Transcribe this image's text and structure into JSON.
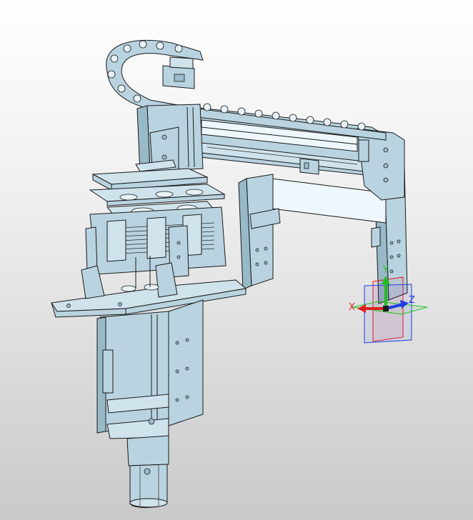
{
  "viewport": {
    "background_top": "#ffffff",
    "background_bottom": "#c9c9c9"
  },
  "model": {
    "part_color": "#b9d4e0",
    "edge_color": "#1a1a1a"
  },
  "triad": {
    "x_label": "X",
    "y_label": "Y",
    "z_label": "Z",
    "x_color": "#e02020",
    "y_color": "#20c020",
    "z_color": "#2040e0",
    "plane_xy_color": "#2040e0",
    "plane_yz_color": "#e02020",
    "plane_xz_color": "#20c020"
  }
}
